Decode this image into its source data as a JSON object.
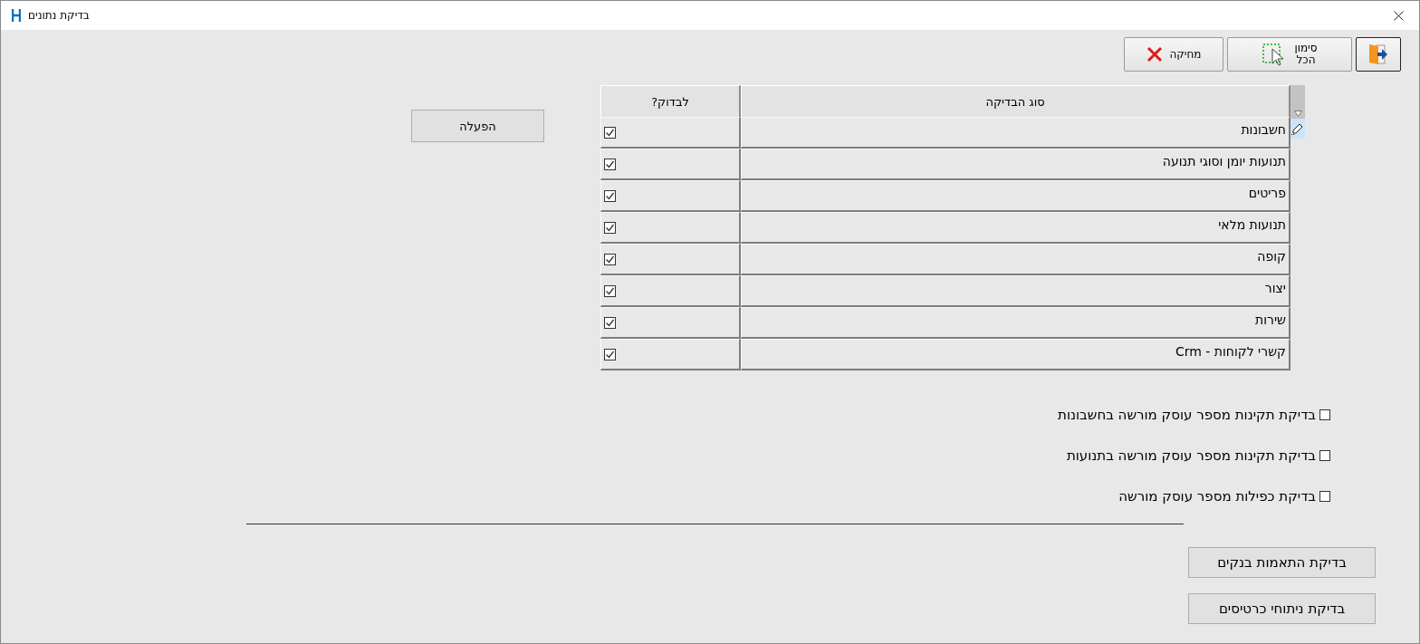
{
  "window": {
    "title": "בדיקת נתונים"
  },
  "toolbar": [
    {
      "kind": "exit",
      "focused": true
    },
    {
      "kind": "select_all",
      "label": "סימון הכל",
      "focused": false
    },
    {
      "kind": "delete",
      "label": "מחיקה",
      "focused": false
    }
  ],
  "run_button": {
    "label": "הפעלה"
  },
  "table": {
    "columns": [
      {
        "label": "סוג הבדיקה"
      },
      {
        "label": "לבדוק?"
      }
    ],
    "rows": [
      {
        "type": "חשבונות",
        "checked": true,
        "editing": true
      },
      {
        "type": "תנועות יומן וסוגי תנועה",
        "checked": true,
        "editing": false
      },
      {
        "type": "פריטים",
        "checked": true,
        "editing": false
      },
      {
        "type": "תנועות מלאי",
        "checked": true,
        "editing": false
      },
      {
        "type": "קופה",
        "checked": true,
        "editing": false
      },
      {
        "type": "יצור",
        "checked": true,
        "editing": false
      },
      {
        "type": "שירות",
        "checked": true,
        "editing": false
      },
      {
        "type": "קשרי לקוחות - Crm",
        "checked": true,
        "editing": false
      }
    ]
  },
  "options": [
    {
      "label": "בדיקת תקינות מספר עוסק מורשה בחשבונות",
      "checked": false
    },
    {
      "label": "בדיקת תקינות מספר עוסק מורשה בתנועות",
      "checked": false
    },
    {
      "label": "בדיקת כפילות מספר עוסק מורשה",
      "checked": false
    }
  ],
  "actions": [
    {
      "label": "בדיקת התאמות בנקים"
    },
    {
      "label": "בדיקת ניתוחי כרטיסים"
    }
  ]
}
